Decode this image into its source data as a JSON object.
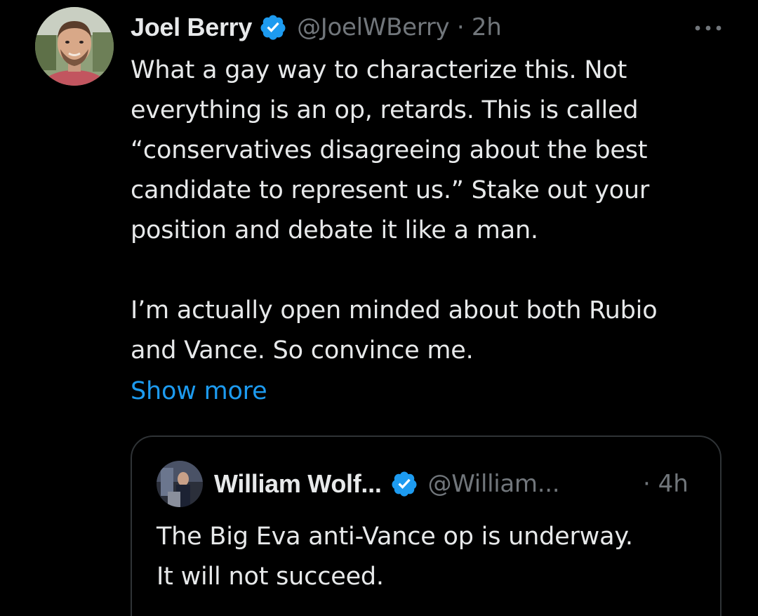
{
  "tweet": {
    "author_name": "Joel Berry",
    "handle": "@JoelWBerry",
    "separator": "·",
    "time": "2h",
    "more_icon": "more-horizontal-icon",
    "verified_icon": "verified-badge-icon",
    "body_lines": [
      "What a gay way to characterize this. Not",
      "everything is an op, retards. This is called",
      "“conservatives disagreeing about the best",
      "candidate to represent us.” Stake out your",
      "position and debate it like a man."
    ],
    "body_lines_2": [
      "I’m actually open minded about both Rubio",
      "and Vance. So convince me."
    ],
    "show_more": "Show more"
  },
  "quoted_tweet": {
    "author_name": "William Wolf...",
    "handle": "@William...",
    "time": "· 4h",
    "body_lines": [
      "The Big Eva anti-Vance op is underway.",
      "It will not succeed."
    ]
  },
  "colors": {
    "background": "#000000",
    "text": "#e7e9ea",
    "secondary": "#71767b",
    "link": "#1d9bf0",
    "badge": "#1d9bf0",
    "border": "#2f3336"
  }
}
